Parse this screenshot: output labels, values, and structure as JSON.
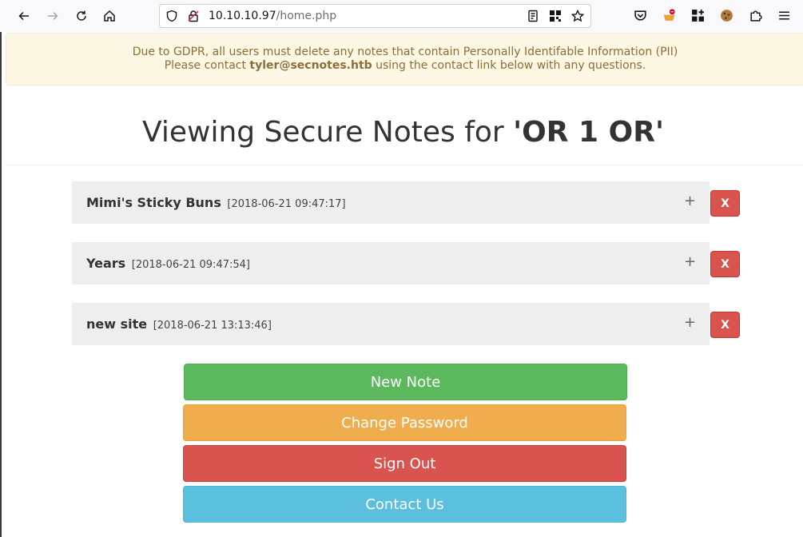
{
  "browser": {
    "url_host": "10.10.10.97",
    "url_path": "/home.php"
  },
  "alert": {
    "line1": "Due to GDPR, all users must delete any notes that contain Personally Identifable Information (PII)",
    "line2_prefix": "Please contact ",
    "email": "tyler@secnotes.htb",
    "line2_suffix": " using the contact link below with any questions."
  },
  "heading": {
    "prefix": "Viewing Secure Notes for ",
    "username": "'OR 1 OR'"
  },
  "notes": [
    {
      "title": "Mimi's Sticky Buns",
      "date": "[2018-06-21 09:47:17]",
      "expand": "+",
      "delete": "X"
    },
    {
      "title": "Years",
      "date": "[2018-06-21 09:47:54]",
      "expand": "+",
      "delete": "X"
    },
    {
      "title": "new site",
      "date": "[2018-06-21 13:13:46]",
      "expand": "+",
      "delete": "X"
    }
  ],
  "actions": {
    "new_note": "New Note",
    "change_password": "Change Password",
    "sign_out": "Sign Out",
    "contact_us": "Contact Us"
  },
  "colors": {
    "success": "#5cb85c",
    "warning": "#f0ad4e",
    "danger": "#d9534f",
    "info": "#5bc0de",
    "alert_bg": "#fcf8e3",
    "alert_text": "#8a6d3b"
  }
}
